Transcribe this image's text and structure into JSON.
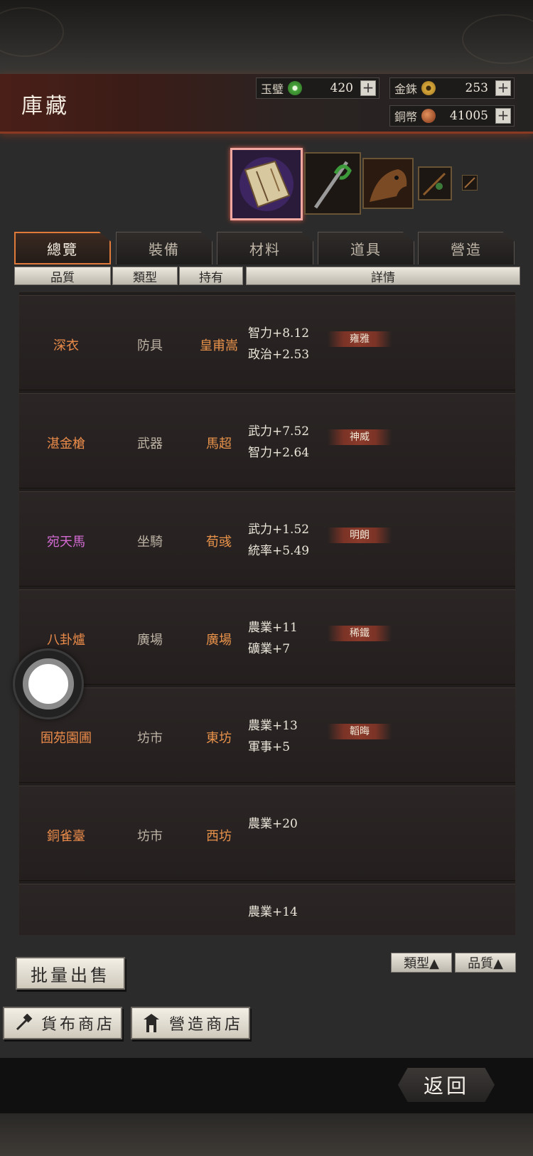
{
  "header": {
    "title": "庫藏"
  },
  "currencies": [
    {
      "label": "玉璧",
      "icon": "jade-coin-icon",
      "value": "420"
    },
    {
      "label": "金銖",
      "icon": "gold-coin-icon",
      "value": "253"
    },
    {
      "label": "銅幣",
      "icon": "copper-coin-icon",
      "value": "41005"
    }
  ],
  "thumbnails": [
    {
      "icon": "book-item-icon"
    },
    {
      "icon": "spear-item-icon"
    },
    {
      "icon": "horse-item-icon"
    },
    {
      "icon": "arrow-item-icon"
    },
    {
      "icon": "small-item-icon"
    }
  ],
  "tabs": [
    "總覽",
    "裝備",
    "材料",
    "道具",
    "營造"
  ],
  "sort_headers": {
    "quality": "品質",
    "type": "類型",
    "holder": "持有",
    "details": "詳情"
  },
  "rows": [
    {
      "name": "深衣",
      "quality": "orange",
      "type": "防具",
      "holder": "皇甫嵩",
      "stats": [
        "智力+8.12",
        "政治+2.53"
      ],
      "tag": "雍雅"
    },
    {
      "name": "湛金槍",
      "quality": "orange",
      "type": "武器",
      "holder": "馬超",
      "stats": [
        "武力+7.52",
        "智力+2.64"
      ],
      "tag": "神威"
    },
    {
      "name": "宛天馬",
      "quality": "purple",
      "type": "坐騎",
      "holder": "荀彧",
      "stats": [
        "武力+1.52",
        "統率+5.49"
      ],
      "tag": "明朗"
    },
    {
      "name": "八卦爐",
      "quality": "orange",
      "type": "廣場",
      "holder": "廣場",
      "stats": [
        "農業+11",
        "礦業+7"
      ],
      "tag": "稀鐵"
    },
    {
      "name": "囿苑園圃",
      "quality": "orange",
      "type": "坊市",
      "holder": "東坊",
      "stats": [
        "農業+13",
        "軍事+5"
      ],
      "tag": "韜晦"
    },
    {
      "name": "銅雀臺",
      "quality": "orange",
      "type": "坊市",
      "holder": "西坊",
      "stats": [
        "農業+20"
      ],
      "tag": ""
    },
    {
      "name": "",
      "quality": "orange",
      "type": "",
      "holder": "",
      "stats": [
        "農業+14"
      ],
      "tag": ""
    }
  ],
  "filters": {
    "type": "類型▲",
    "quality": "品質▲"
  },
  "buttons": {
    "bulk_sell": "批量出售",
    "currency_shop": "貨布商店",
    "build_shop": "營造商店",
    "back": "返回"
  },
  "colors": {
    "orange": "#ec8c4a",
    "purple": "#d36ad2",
    "accent": "#e07a3a"
  }
}
